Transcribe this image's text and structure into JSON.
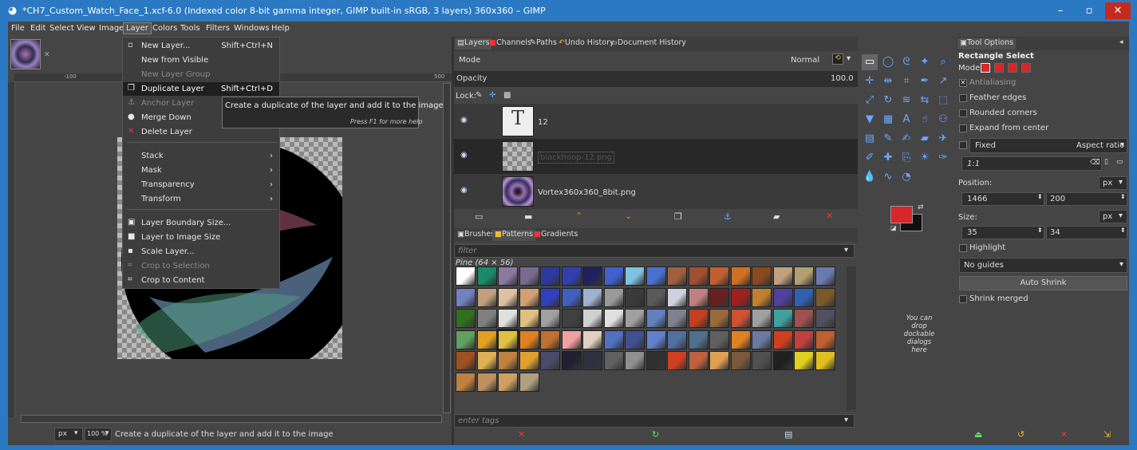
{
  "window": {
    "title": "*CH7_Custom_Watch_Face_1.xcf-6.0 (Indexed color 8-bit gamma integer, GIMP built-in sRGB, 3 layers) 360x360 – GIMP",
    "minimize_glyph": "–",
    "maximize_glyph": "▫",
    "close_glyph": "✕"
  },
  "menubar": [
    "File",
    "Edit",
    "Select",
    "View",
    "Image",
    "Layer",
    "Colors",
    "Tools",
    "Filters",
    "Windows",
    "Help"
  ],
  "layer_menu": {
    "items": [
      {
        "label": "New Layer...",
        "shortcut": "Shift+Ctrl+N",
        "enabled": true
      },
      {
        "label": "New from Visible",
        "shortcut": "",
        "enabled": true
      },
      {
        "label": "New Layer Group",
        "shortcut": "",
        "enabled": false
      },
      {
        "label": "Duplicate Layer",
        "shortcut": "Shift+Ctrl+D",
        "enabled": true,
        "highlighted": true
      },
      {
        "label": "Anchor Layer",
        "shortcut": "",
        "enabled": false
      },
      {
        "label": "Merge Down",
        "shortcut": "",
        "enabled": true
      },
      {
        "label": "Delete Layer",
        "shortcut": "",
        "enabled": true
      },
      {
        "label": "Stack",
        "submenu": true
      },
      {
        "label": "Mask",
        "submenu": true
      },
      {
        "label": "Transparency",
        "submenu": true
      },
      {
        "label": "Transform",
        "submenu": true
      },
      {
        "label": "Layer Boundary Size...",
        "enabled": true
      },
      {
        "label": "Layer to Image Size",
        "enabled": true
      },
      {
        "label": "Scale Layer...",
        "enabled": true
      },
      {
        "label": "Crop to Selection",
        "enabled": false
      },
      {
        "label": "Crop to Content",
        "enabled": true
      }
    ]
  },
  "tooltip": {
    "text": "Create a duplicate of the layer and add it to the image",
    "hint": "Press F1 for more help"
  },
  "canvas": {
    "ruler_labels": [
      "-100",
      "500"
    ],
    "unit": "px",
    "zoom": "100 %",
    "status": "Create a duplicate of the layer and add it to the image"
  },
  "layers_panel": {
    "tabs": [
      "Layers",
      "Channels",
      "Paths",
      "Undo History",
      "Document History"
    ],
    "mode_label": "Mode",
    "mode_value": "Normal",
    "opacity_label": "Opacity",
    "opacity_value": "100.0",
    "lock_label": "Lock:",
    "layers": [
      {
        "name": "12",
        "kind": "text"
      },
      {
        "name": "blackhoop-12.png",
        "kind": "image"
      },
      {
        "name": "Vortex360x360_8bit.png",
        "kind": "image"
      }
    ]
  },
  "patterns_panel": {
    "tabs": [
      "Brushes",
      "Patterns",
      "Gradients"
    ],
    "filter_placeholder": "filter",
    "selected": "Pine (64 × 56)",
    "tags_placeholder": "enter tags",
    "colors": [
      "#ffffff",
      "#1a8a6a",
      "#8a7aa0",
      "#7a6a90",
      "#2a3aa0",
      "#3040b0",
      "#202060",
      "#4060d0",
      "#80c0e0",
      "#4a70d0",
      "#a06040",
      "#a05030",
      "#c06030",
      "#d07020",
      "#8a4a20",
      "#c0a080",
      "#b0a070",
      "#6a7ab0",
      "#7080c0",
      "#c0a080",
      "#e0c0a0",
      "#d0a070",
      "#3040c0",
      "#4060c0",
      "#a0b0d0",
      "#9a9a9a",
      "#3a3a3a",
      "#5a5a5a",
      "#d0d0e0",
      "#c08080",
      "#6a2020",
      "#a02020",
      "#c08030",
      "#5040a0",
      "#3060b0",
      "#7a5a2a",
      "#307020",
      "#808080",
      "#e0e0e0",
      "#e0c080",
      "#a0a0a0",
      "#404040",
      "#d0d0d0",
      "#e0e0e0",
      "#a0a0a0",
      "#6080c0",
      "#808090",
      "#c04020",
      "#9a6a3a",
      "#d05030",
      "#a0a0a0",
      "#40a0a0",
      "#a05050",
      "#505060",
      "#60a060",
      "#e0a020",
      "#e0c040",
      "#e08020",
      "#c07030",
      "#f0a0a0",
      "#e0d0c0",
      "#5070c0",
      "#405090",
      "#6080d0",
      "#5070a0",
      "#507090",
      "#606060",
      "#e08020",
      "#6a7aa0",
      "#d04020",
      "#c04040",
      "#c06030",
      "#a05020",
      "#e0b050",
      "#c08040",
      "#e0a030",
      "#4a4a6a",
      "#202030",
      "#303040",
      "#606060",
      "#909090",
      "#303030",
      "#d04020",
      "#c06040",
      "#e0a050",
      "#7a5a3a",
      "#505050",
      "#202020",
      "#e0d020",
      "#e0c020",
      "#c08040",
      "#c09060",
      "#d0a060",
      "#b0a080"
    ]
  },
  "toolbox": {
    "dock_hint": "You can drop dockable dialogs here",
    "fg_color": "#d8262a",
    "bg_color": "#101010",
    "tool_icons": [
      "rect-select",
      "ellipse-select",
      "free-select",
      "fuzzy-select",
      "zoom",
      "move",
      "align",
      "crop",
      "path",
      "measure",
      "scale",
      "rotate",
      "warp",
      "flip",
      "transform",
      "bucket",
      "blend",
      "text",
      "smudge",
      "clone",
      "gradient",
      "pencil",
      "brush",
      "eraser",
      "airbrush",
      "ink",
      "heal",
      "perspective-clone",
      "dodge",
      "color-picker",
      "blur",
      "smudge-2",
      "curves"
    ]
  },
  "tool_options": {
    "tab": "Tool Options",
    "title": "Rectangle Select",
    "mode_label": "Mode:",
    "antialiasing": "Antialiasing",
    "feather": "Feather edges",
    "rounded": "Rounded corners",
    "expand": "Expand from center",
    "fixed": "Fixed",
    "fixed_value": "Aspect ratio",
    "ratio": "1:1",
    "position_label": "Position:",
    "pos_unit": "px",
    "pos_x": "1466",
    "pos_y": "200",
    "size_label": "Size:",
    "size_unit": "px",
    "size_w": "35",
    "size_h": "34",
    "highlight": "Highlight",
    "guides": "No guides",
    "auto_shrink": "Auto Shrink",
    "shrink_merged": "Shrink merged"
  }
}
